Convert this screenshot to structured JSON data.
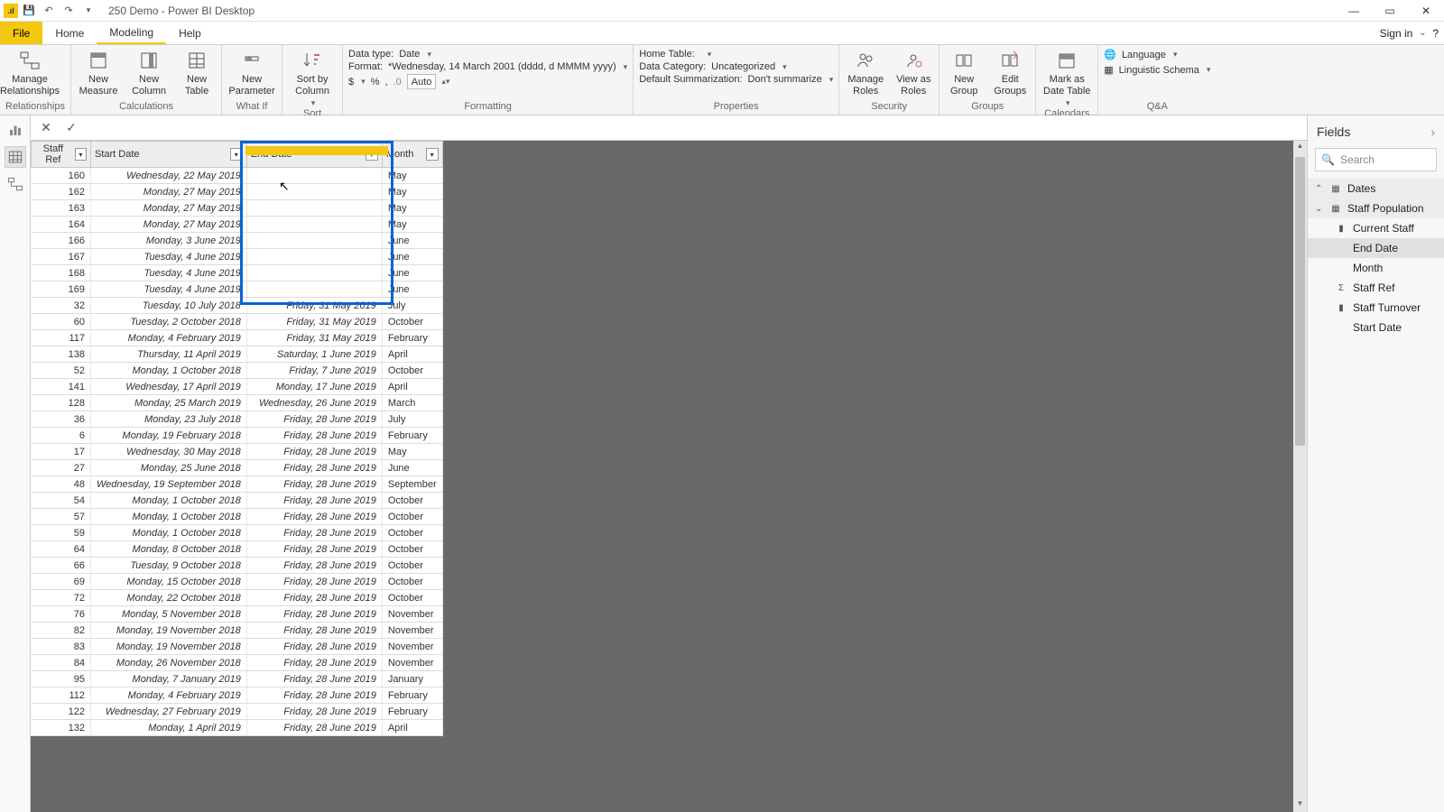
{
  "title": "250 Demo - Power BI Desktop",
  "signin": "Sign in",
  "tabs": {
    "file": "File",
    "home": "Home",
    "modeling": "Modeling",
    "help": "Help"
  },
  "ribbon": {
    "relationships": {
      "manage": "Manage\nRelationships",
      "group": "Relationships"
    },
    "calc": {
      "measure": "New\nMeasure",
      "column": "New\nColumn",
      "table": "New\nTable",
      "group": "Calculations"
    },
    "whatif": {
      "param": "New\nParameter",
      "group": "What If"
    },
    "sort": {
      "btn": "Sort by\nColumn",
      "group": "Sort"
    },
    "formatting": {
      "datatype_lbl": "Data type:",
      "datatype_val": "Date",
      "format_lbl": "Format:",
      "format_val": "*Wednesday, 14 March 2001 (dddd, d MMMM yyyy)",
      "currency": "$",
      "percent": "%",
      "comma": ",",
      "auto": "Auto",
      "group": "Formatting"
    },
    "properties": {
      "hometable_lbl": "Home Table:",
      "hometable_val": "",
      "datacat_lbl": "Data Category:",
      "datacat_val": "Uncategorized",
      "summ_lbl": "Default Summarization:",
      "summ_val": "Don't summarize",
      "group": "Properties"
    },
    "security": {
      "manage": "Manage\nRoles",
      "view": "View as\nRoles",
      "group": "Security"
    },
    "groups": {
      "new": "New\nGroup",
      "edit": "Edit\nGroups",
      "group": "Groups"
    },
    "calendars": {
      "mark": "Mark as\nDate Table",
      "group": "Calendars"
    },
    "qa": {
      "lang": "Language",
      "schema": "Linguistic Schema",
      "group": "Q&A"
    }
  },
  "columns": {
    "staff": "Staff Ref",
    "start": "Start Date",
    "end": "End Date",
    "month": "Month"
  },
  "rows": [
    {
      "r": "160",
      "s": "Wednesday, 22 May 2019",
      "e": "",
      "m": "May"
    },
    {
      "r": "162",
      "s": "Monday, 27 May 2019",
      "e": "",
      "m": "May"
    },
    {
      "r": "163",
      "s": "Monday, 27 May 2019",
      "e": "",
      "m": "May"
    },
    {
      "r": "164",
      "s": "Monday, 27 May 2019",
      "e": "",
      "m": "May"
    },
    {
      "r": "166",
      "s": "Monday, 3 June 2019",
      "e": "",
      "m": "June"
    },
    {
      "r": "167",
      "s": "Tuesday, 4 June 2019",
      "e": "",
      "m": "June"
    },
    {
      "r": "168",
      "s": "Tuesday, 4 June 2019",
      "e": "",
      "m": "June"
    },
    {
      "r": "169",
      "s": "Tuesday, 4 June 2019",
      "e": "",
      "m": "June"
    },
    {
      "r": "32",
      "s": "Tuesday, 10 July 2018",
      "e": "Friday, 31 May 2019",
      "m": "July"
    },
    {
      "r": "60",
      "s": "Tuesday, 2 October 2018",
      "e": "Friday, 31 May 2019",
      "m": "October"
    },
    {
      "r": "117",
      "s": "Monday, 4 February 2019",
      "e": "Friday, 31 May 2019",
      "m": "February"
    },
    {
      "r": "138",
      "s": "Thursday, 11 April 2019",
      "e": "Saturday, 1 June 2019",
      "m": "April"
    },
    {
      "r": "52",
      "s": "Monday, 1 October 2018",
      "e": "Friday, 7 June 2019",
      "m": "October"
    },
    {
      "r": "141",
      "s": "Wednesday, 17 April 2019",
      "e": "Monday, 17 June 2019",
      "m": "April"
    },
    {
      "r": "128",
      "s": "Monday, 25 March 2019",
      "e": "Wednesday, 26 June 2019",
      "m": "March"
    },
    {
      "r": "36",
      "s": "Monday, 23 July 2018",
      "e": "Friday, 28 June 2019",
      "m": "July"
    },
    {
      "r": "6",
      "s": "Monday, 19 February 2018",
      "e": "Friday, 28 June 2019",
      "m": "February"
    },
    {
      "r": "17",
      "s": "Wednesday, 30 May 2018",
      "e": "Friday, 28 June 2019",
      "m": "May"
    },
    {
      "r": "27",
      "s": "Monday, 25 June 2018",
      "e": "Friday, 28 June 2019",
      "m": "June"
    },
    {
      "r": "48",
      "s": "Wednesday, 19 September 2018",
      "e": "Friday, 28 June 2019",
      "m": "September"
    },
    {
      "r": "54",
      "s": "Monday, 1 October 2018",
      "e": "Friday, 28 June 2019",
      "m": "October"
    },
    {
      "r": "57",
      "s": "Monday, 1 October 2018",
      "e": "Friday, 28 June 2019",
      "m": "October"
    },
    {
      "r": "59",
      "s": "Monday, 1 October 2018",
      "e": "Friday, 28 June 2019",
      "m": "October"
    },
    {
      "r": "64",
      "s": "Monday, 8 October 2018",
      "e": "Friday, 28 June 2019",
      "m": "October"
    },
    {
      "r": "66",
      "s": "Tuesday, 9 October 2018",
      "e": "Friday, 28 June 2019",
      "m": "October"
    },
    {
      "r": "69",
      "s": "Monday, 15 October 2018",
      "e": "Friday, 28 June 2019",
      "m": "October"
    },
    {
      "r": "72",
      "s": "Monday, 22 October 2018",
      "e": "Friday, 28 June 2019",
      "m": "October"
    },
    {
      "r": "76",
      "s": "Monday, 5 November 2018",
      "e": "Friday, 28 June 2019",
      "m": "November"
    },
    {
      "r": "82",
      "s": "Monday, 19 November 2018",
      "e": "Friday, 28 June 2019",
      "m": "November"
    },
    {
      "r": "83",
      "s": "Monday, 19 November 2018",
      "e": "Friday, 28 June 2019",
      "m": "November"
    },
    {
      "r": "84",
      "s": "Monday, 26 November 2018",
      "e": "Friday, 28 June 2019",
      "m": "November"
    },
    {
      "r": "95",
      "s": "Monday, 7 January 2019",
      "e": "Friday, 28 June 2019",
      "m": "January"
    },
    {
      "r": "112",
      "s": "Monday, 4 February 2019",
      "e": "Friday, 28 June 2019",
      "m": "February"
    },
    {
      "r": "122",
      "s": "Wednesday, 27 February 2019",
      "e": "Friday, 28 June 2019",
      "m": "February"
    },
    {
      "r": "132",
      "s": "Monday, 1 April 2019",
      "e": "Friday, 28 June 2019",
      "m": "April"
    }
  ],
  "fields": {
    "title": "Fields",
    "search": "Search",
    "tables": [
      {
        "name": "Dates",
        "expanded": false,
        "items": []
      },
      {
        "name": "Staff Population",
        "expanded": true,
        "items": [
          {
            "name": "Current Staff",
            "icon": "measure"
          },
          {
            "name": "End Date",
            "icon": "",
            "sel": true
          },
          {
            "name": "Month",
            "icon": ""
          },
          {
            "name": "Staff Ref",
            "icon": "sigma"
          },
          {
            "name": "Staff Turnover",
            "icon": "measure"
          },
          {
            "name": "Start Date",
            "icon": ""
          }
        ]
      }
    ]
  }
}
